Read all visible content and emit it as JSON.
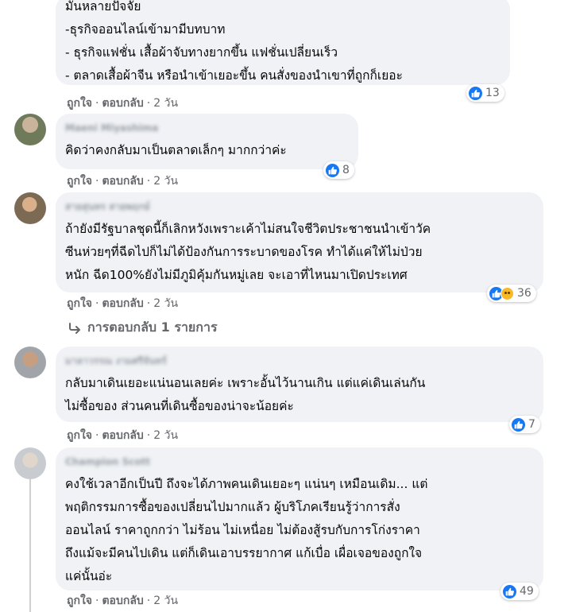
{
  "comments": [
    {
      "author": "",
      "text": "มันหลายปัจจัย\n-ธุรกิจออนไลน์เข้ามามีบทบาท\n- ธุรกิจแฟชั่น เสื้อผ้าจับทางยากขึ้น แฟชั่นเปลี่ยนเร็ว\n- ตลาดเสื้อผ้าจีน หรือนำเข้าเยอะขึ้น คนสั่งของนำเขาที่ถูกก็เยอะ",
      "reactions": "13",
      "like": "ถูกใจ",
      "reply": "ตอบกลับ",
      "time": "2 วัน"
    },
    {
      "author": "Maeni Miyashima",
      "text": "คิดว่าคงกลับมาเป็นตลาดเล็กๆ มากกว่าค่ะ",
      "reactions": "8",
      "like": "ถูกใจ",
      "reply": "ตอบกลับ",
      "time": "2 วัน"
    },
    {
      "author": "สายสุนทร สายพฤกษ์",
      "text": "ถ้ายังมีรัฐบาลชุดนี้ก็เลิกหวังเพราะเค้าไม่สนใจชีวิตประชาชนนำเข้าวัค\nซีนห่วยๆที่ฉีดไปก็ไม่ได้ป้องกันการระบาดของโรค ทำได้แค่ให้ไม่ป่วย\nหนัก ฉีด100%ยังไม่มีภูมิคุ้มกันหมู่เลย จะเอาที่ไหนมาเปิดประเทศ",
      "reactions": "36",
      "like": "ถูกใจ",
      "reply": "ตอบกลับ",
      "time": "2 วัน",
      "view_replies": "การตอบกลับ 1 รายการ"
    },
    {
      "author": "มาลาวรรณ งามศรีจันทร์",
      "text": "กลับมาเดินเยอะแน่นอนเลยค่ะ เพราะอั้นไว้นานเกิน แต่แค่เดินเล่นกัน\nไม่ซื้อของ ส่วนคนที่เดินซื้อของน่าจะน้อยค่ะ",
      "reactions": "7",
      "like": "ถูกใจ",
      "reply": "ตอบกลับ",
      "time": "2 วัน"
    },
    {
      "author": "Champion Scott",
      "text": "คงใช้เวลาอีกเป็นปี ถึงจะได้ภาพคนเดินเยอะๆ แน่นๆ เหมือนเดิม... แต่\nพฤติกรรมการซื้อของเปลี่ยนไปมากแล้ว ผู้บริโภคเรียนรู้ว่าการสั่ง\nออนไลน์ ราคาถูกกว่า ไม่ร้อน ไม่เหนื่อย ไม่ต้องสู้รบกับการโก่งราคา\nถึงแม้จะมีคนไปเดิน แต่ก็เดินเอาบรรยากาศ แก้เบื่อ เผื่อเจอของถูกใจ\nแค่นั้นอ่ะ",
      "reactions": "49",
      "like": "ถูกใจ",
      "reply": "ตอบกลับ",
      "time": "2 วัน"
    }
  ],
  "colors": {
    "like_blue": "#1877f2",
    "bubble_bg": "#f0f2f5",
    "meta_gray": "#65676b"
  },
  "icons": [
    "like-icon",
    "sad-icon",
    "reply-arrow-icon",
    "avatar"
  ]
}
